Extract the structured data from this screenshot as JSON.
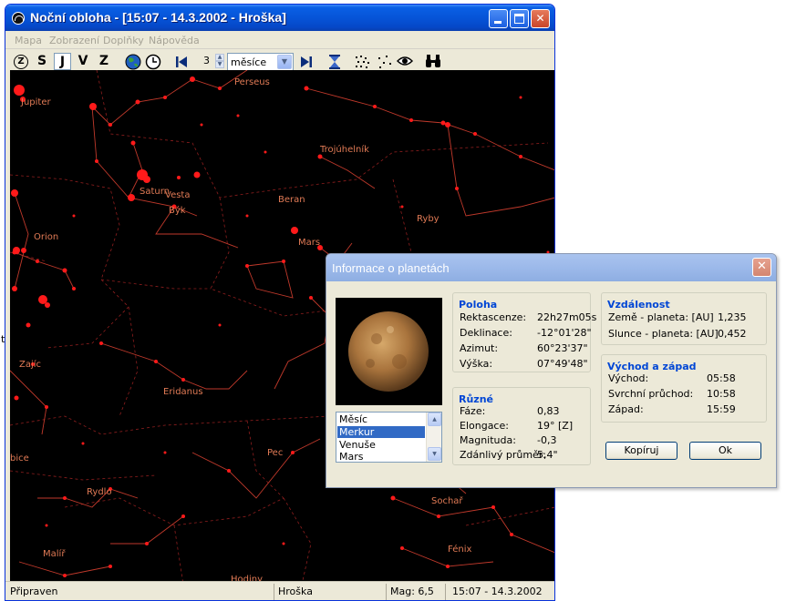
{
  "window": {
    "title": "Noční obloha - [15:07 - 14.3.2002 - Hroška]"
  },
  "menu": [
    "Mapa",
    "Zobrazení",
    "Doplňky",
    "Nápověda"
  ],
  "toolbar": {
    "directions": [
      "Z",
      "S",
      "J",
      "V",
      "Z"
    ],
    "step_value": "3",
    "unit_value": "měsíce",
    "icons": [
      "zenith-icon",
      "globe-icon",
      "clock-icon",
      "skip-back-icon",
      "skip-forward-icon",
      "hourglass-icon",
      "stars-dense-icon",
      "stars-sparse-icon",
      "eye-icon",
      "binoculars-icon"
    ]
  },
  "sky_labels": {
    "jupiter": "Jupiter",
    "perseus": "Perseus",
    "trojuhelnik": "Trojúhelník",
    "saturn": "Saturn",
    "vesta": "Vesta",
    "byk": "Býk",
    "beran": "Beran",
    "ryby": "Ryby",
    "orion": "Orion",
    "mars": "Mars",
    "zajic": "Zajíc",
    "eridanus": "Eridanus",
    "pec": "Pec",
    "rydlo": "Rydlo",
    "sochar": "Sochař",
    "fenix": "Fénix",
    "malir": "Malíř",
    "hodiny": "Hodiny",
    "holubice": "bice"
  },
  "status": {
    "state": "Připraven",
    "location": "Hroška",
    "mag": "Mag: 6,5",
    "datetime": "15:07 - 14.3.2002"
  },
  "dialog": {
    "title": "Informace o planetách",
    "planets": [
      "Měsíc",
      "Merkur",
      "Venuše",
      "Mars"
    ],
    "selected": "Merkur",
    "poloha": {
      "title": "Poloha",
      "rows": [
        {
          "label": "Rektascenze:",
          "value": "22h27m05s"
        },
        {
          "label": "Deklinace:",
          "value": "-12°01'28\""
        },
        {
          "label": "Azimut:",
          "value": "60°23'37\""
        },
        {
          "label": "Výška:",
          "value": "07°49'48\""
        }
      ]
    },
    "ruzne": {
      "title": "Různé",
      "rows": [
        {
          "label": "Fáze:",
          "value": "0,83"
        },
        {
          "label": "Elongace:",
          "value": "19° [Z]"
        },
        {
          "label": "Magnituda:",
          "value": "-0,3"
        },
        {
          "label": "Zdánlivý průměr:",
          "value": "5,4\""
        }
      ]
    },
    "vzdalenost": {
      "title": "Vzdálenost",
      "rows": [
        {
          "label": "Země - planeta: [AU]",
          "value": "1,235"
        },
        {
          "label": "Slunce - planeta: [AU]",
          "value": "0,452"
        }
      ]
    },
    "vychod": {
      "title": "Východ a západ",
      "rows": [
        {
          "label": "Východ:",
          "value": "05:58"
        },
        {
          "label": "Svrchní průchod:",
          "value": "10:58"
        },
        {
          "label": "Západ:",
          "value": "15:59"
        }
      ]
    },
    "buttons": {
      "copy": "Kopíruj",
      "ok": "Ok"
    }
  },
  "side_text": "t",
  "colors": {
    "sky": "#000000",
    "star": "#ff1a1a",
    "line": "#c0392b",
    "label": "#e07a55",
    "accent": "#0046d5"
  }
}
